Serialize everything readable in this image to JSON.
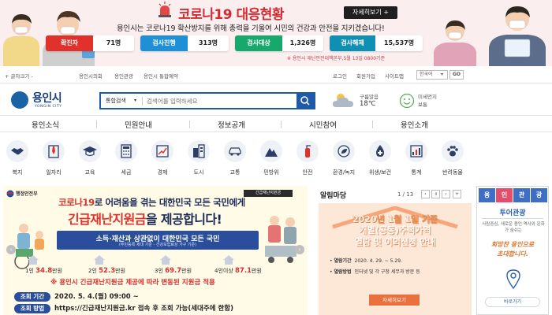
{
  "covid": {
    "title": "코로나19 대응현황",
    "more_label": "자세히보기",
    "description": "용인시는 코로나19 확산방지를 위해 총력을 기울여 시민의 건강과 안전을 지키겠습니다!",
    "stats": [
      {
        "label": "확진자",
        "value": "71명",
        "color": "#e0312a"
      },
      {
        "label": "검사진행",
        "value": "313명",
        "color": "#1f8fd6"
      },
      {
        "label": "검사대상",
        "value": "1,326명",
        "color": "#17a86b"
      },
      {
        "label": "검사해제",
        "value": "15,537명",
        "color": "#0f8fb3"
      }
    ],
    "source": "※ 용인시 재난안전대책본부,5월 13일 0800기준"
  },
  "util_bar": {
    "font_size": "+ 글자크기 -",
    "links_left": [
      "용인시의회",
      "용인관광",
      "용인시 통합예약"
    ],
    "links_right": [
      "로그인",
      "회원가입",
      "사이트맵"
    ],
    "language": "한국어",
    "go_label": "GO"
  },
  "logo": {
    "name": "용인시",
    "sub": "YONGIN CITY"
  },
  "search": {
    "category": "통합검색",
    "placeholder": "검색어를 입력하세요"
  },
  "weather": {
    "label": "구름많음",
    "temp": "18℃"
  },
  "dust": {
    "label": "미세먼지",
    "status": "보통"
  },
  "nav": [
    "용인소식",
    "민원안내",
    "정보공개",
    "시민참여",
    "용인소개"
  ],
  "quick_icons": [
    {
      "label": "복지",
      "icon": "handshake-icon"
    },
    {
      "label": "일자리",
      "icon": "necktie-icon"
    },
    {
      "label": "교육",
      "icon": "graduation-cap-icon"
    },
    {
      "label": "세금",
      "icon": "calculator-icon"
    },
    {
      "label": "경제",
      "icon": "growth-chart-icon"
    },
    {
      "label": "도시",
      "icon": "building-icon"
    },
    {
      "label": "교통",
      "icon": "car-icon"
    },
    {
      "label": "민방위",
      "icon": "mountain-icon"
    },
    {
      "label": "안전",
      "icon": "fire-extinguisher-icon"
    },
    {
      "label": "환경/녹지",
      "icon": "globe-leaf-icon"
    },
    {
      "label": "위생/보건",
      "icon": "medical-cross-icon"
    },
    {
      "label": "통계",
      "icon": "bar-chart-icon"
    },
    {
      "label": "반려동물",
      "icon": "paw-icon"
    }
  ],
  "main_banner": {
    "org": "행정안전부",
    "tag": "긴급재난지원금",
    "headline1_pre": "코로나19",
    "headline1_post": "로 어려움을 겪는 대한민국 모든 국민에게",
    "headline2_pre": "긴급재난지원금",
    "headline2_post": "을 제공합니다!",
    "bar_line1": "소득·재산과 상관없이 대한민국 모든 국민",
    "bar_line2": "(주민등록 세대 기준 - 건강보험료상 가구 기준)",
    "amounts": [
      {
        "persons": "1인",
        "value": "34.8",
        "unit": "만원"
      },
      {
        "persons": "2인",
        "value": "52.3",
        "unit": "만원"
      },
      {
        "persons": "3인",
        "value": "69.7",
        "unit": "만원"
      },
      {
        "persons": "4인이상",
        "value": "87.1",
        "unit": "만원"
      }
    ],
    "warning": "※ 용인시 긴급재난지원금 제공에 따라 변동된 지원금 적용",
    "rows": [
      {
        "key": "조회 기간",
        "value": "2020. 5. 4.(월) 09:00 ~"
      },
      {
        "key": "조회 방법",
        "value": "https://긴급재난지원금.kr 접속 후 조회 가능(세대주에 한함)"
      }
    ]
  },
  "notice": {
    "title": "알림마당",
    "page": "1 / 13",
    "card": {
      "line1": "2020년 1월 1일 기준",
      "line2": "개별(공동)주택가격",
      "line3": "열람 및 이의신청 안내",
      "details": [
        {
          "key": "열람기간",
          "value": "2020. 4. 29. ~ 5.29."
        },
        {
          "key": "열람방법",
          "value": "인터넷 및 각 구청 세무과 방문 등"
        }
      ],
      "button": "자세히보기"
    }
  },
  "tour": {
    "tabs": [
      "용",
      "인",
      "관",
      "광"
    ],
    "title": "투어관광",
    "desc": "사람중심, 새로운 용인 역사와 문화가 숨쉬는",
    "calligraphy1": "희망찬 용인으로",
    "calligraphy2": "초대합니다.",
    "button": "바로가기"
  }
}
